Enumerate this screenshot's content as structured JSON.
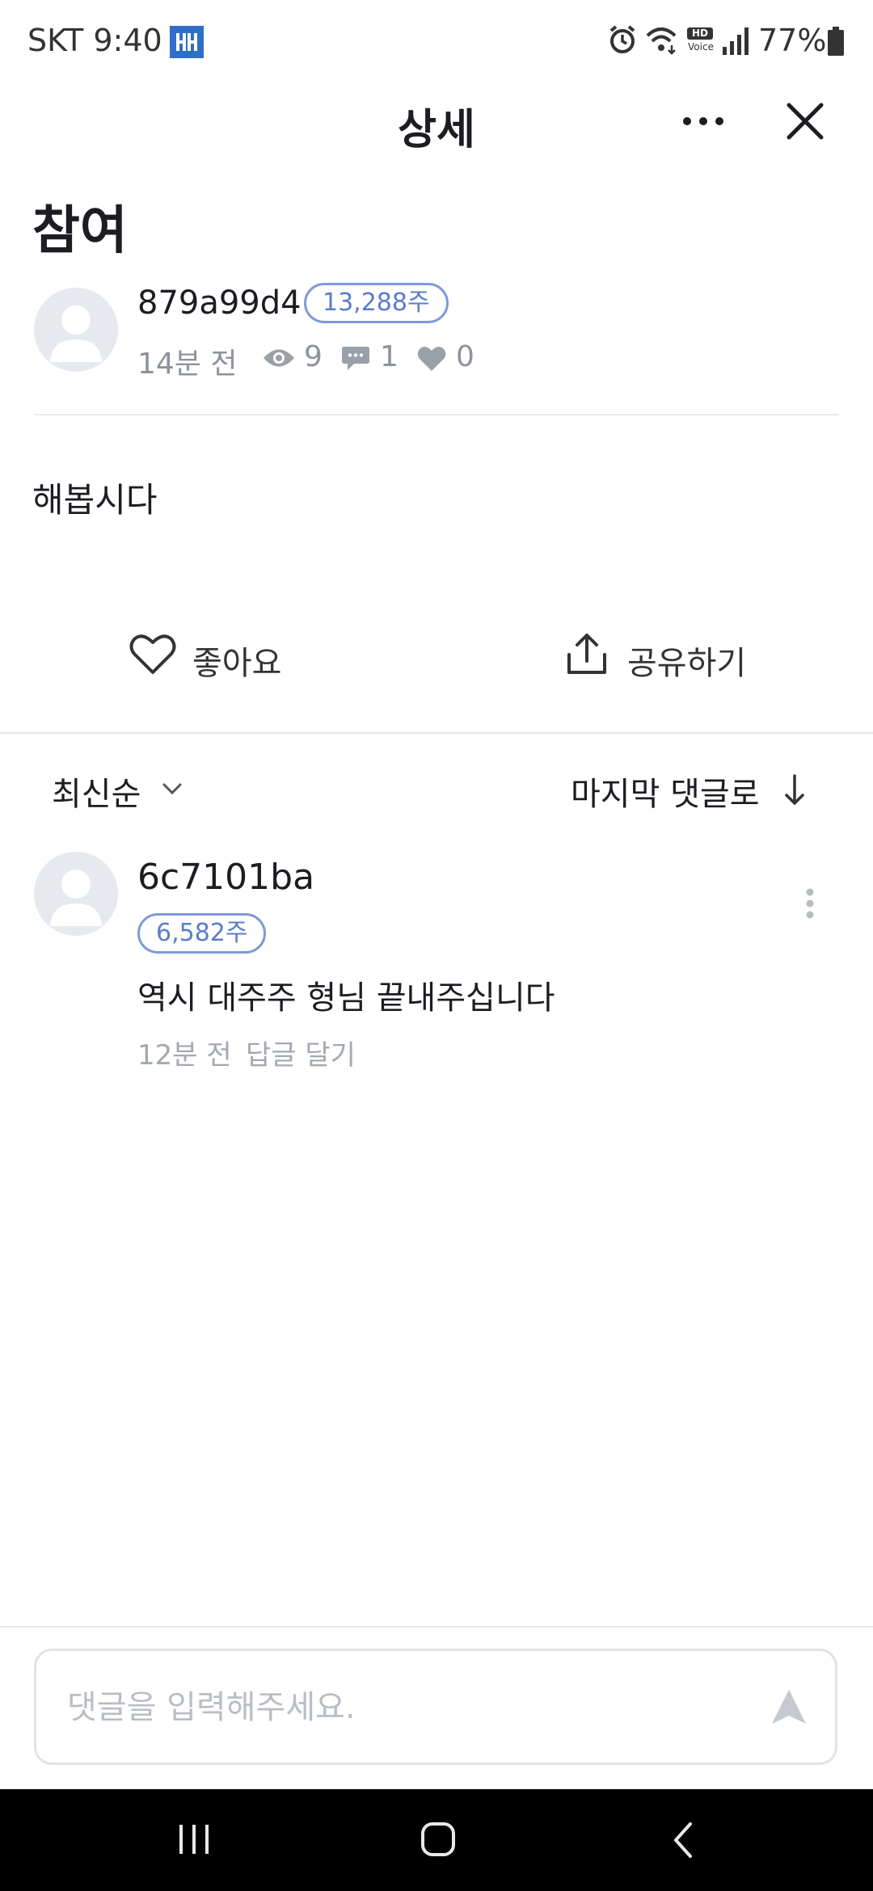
{
  "status_bar": {
    "carrier_time": "SKT 9:40",
    "hd_voice_top": "HD",
    "hd_voice_bottom": "Voice",
    "battery": "77%",
    "icons": [
      "app-notification-icon",
      "alarm-icon",
      "wifi-icon",
      "hd-voice-icon",
      "signal-icon",
      "battery-icon"
    ]
  },
  "header": {
    "title": "상세",
    "icons": [
      "more-icon",
      "close-icon"
    ]
  },
  "post": {
    "title": "참여",
    "author": "879a99d4",
    "shares": "13,288주",
    "time": "14분 전",
    "views": "9",
    "comments": "1",
    "likes": "0",
    "body": "해봅시다"
  },
  "actions": {
    "like_label": "좋아요",
    "share_label": "공유하기"
  },
  "comments_section": {
    "sort_label": "최신순",
    "jump_label": "마지막 댓글로",
    "items": [
      {
        "author": "6c7101ba",
        "shares": "6,582주",
        "text": "역시 대주주 형님 끝내주십니다",
        "time": "12분 전",
        "reply_label": "답글 달기"
      }
    ]
  },
  "comment_input": {
    "placeholder": "댓글을 입력해주세요."
  },
  "nav_bar": {
    "icons": [
      "recent-apps-icon",
      "home-icon",
      "back-icon"
    ]
  }
}
